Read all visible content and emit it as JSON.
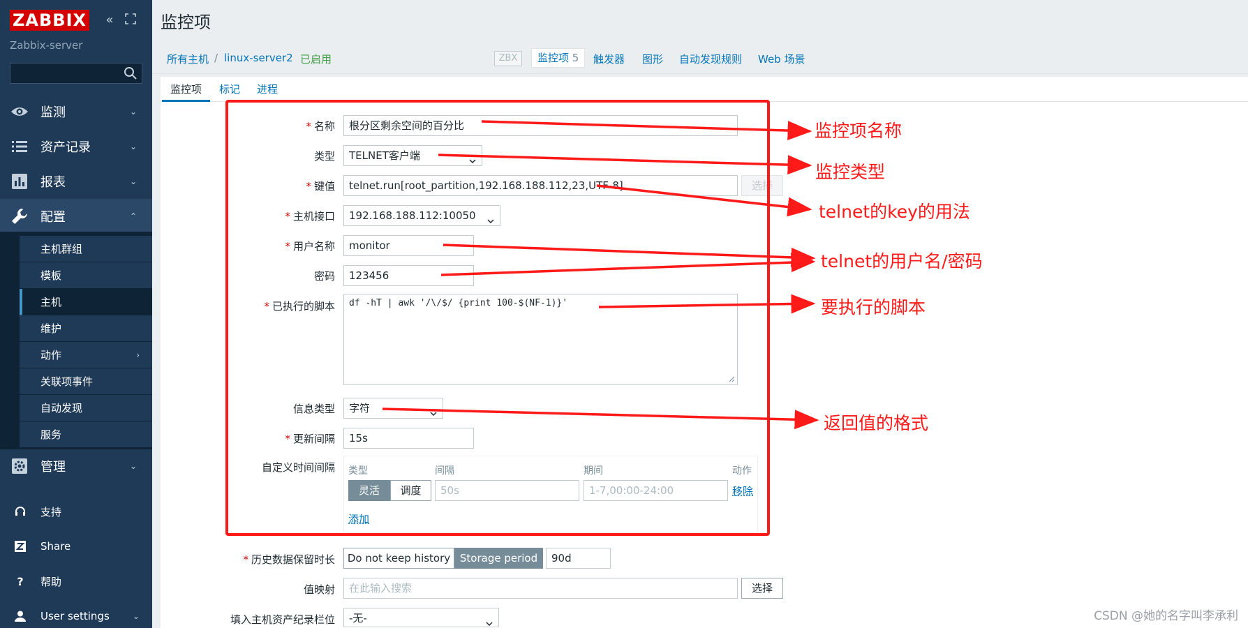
{
  "sidebar": {
    "logo": "ZABBIX",
    "server": "Zabbix-server",
    "search_placeholder": "",
    "menu": [
      {
        "label": "监测"
      },
      {
        "label": "资产记录"
      },
      {
        "label": "报表"
      },
      {
        "label": "配置"
      },
      {
        "label": "管理"
      }
    ],
    "config_sub": [
      {
        "label": "主机群组"
      },
      {
        "label": "模板"
      },
      {
        "label": "主机"
      },
      {
        "label": "维护"
      },
      {
        "label": "动作"
      },
      {
        "label": "关联项事件"
      },
      {
        "label": "自动发现"
      },
      {
        "label": "服务"
      }
    ],
    "bottom": [
      {
        "label": "支持"
      },
      {
        "label": "Share"
      },
      {
        "label": "帮助"
      },
      {
        "label": "User settings"
      }
    ]
  },
  "page_title": "监控项",
  "hostbar": {
    "all_hosts": "所有主机",
    "separator": "/",
    "host": "linux-server2",
    "status": "已启用",
    "zbx": "ZBX",
    "items_label": "监控项",
    "items_count": "5",
    "triggers": "触发器",
    "graphs": "图形",
    "discovery": "自动发现规则",
    "web": "Web 场景"
  },
  "tabs": [
    "监控项",
    "标记",
    "进程"
  ],
  "form": {
    "name_label": "名称",
    "name_value": "根分区剩余空间的百分比",
    "type_label": "类型",
    "type_value": "TELNET客户端",
    "key_label": "键值",
    "key_value": "telnet.run[root_partition,192.168.188.112,23,UTF-8]",
    "key_select": "选择",
    "iface_label": "主机接口",
    "iface_value": "192.168.188.112:10050",
    "user_label": "用户名称",
    "user_value": "monitor",
    "pass_label": "密码",
    "pass_value": "123456",
    "script_label": "已执行的脚本",
    "script_value": "df -hT | awk '/\\/$/ {print 100-$(NF-1)}'",
    "info_label": "信息类型",
    "info_value": "字符",
    "interval_label": "更新间隔",
    "interval_value": "15s",
    "custom_label": "自定义时间间隔",
    "custom": {
      "col_type": "类型",
      "col_interval": "间隔",
      "col_period": "期间",
      "col_action": "动作",
      "flexible": "灵活",
      "scheduling": "调度",
      "interval_placeholder": "50s",
      "period_placeholder": "1-7,00:00-24:00",
      "remove": "移除",
      "add": "添加"
    },
    "history_label": "历史数据保留时长",
    "history_off": "Do not keep history",
    "history_on": "Storage period",
    "history_value": "90d",
    "valuemap_label": "值映射",
    "valuemap_placeholder": "在此输入搜索",
    "valuemap_select": "选择",
    "inventory_label": "填入主机资产纪录栏位",
    "inventory_value": "-无-"
  },
  "annotations": {
    "name": "监控项名称",
    "type": "监控类型",
    "key": "telnet的key的用法",
    "userpass": "telnet的用户名/密码",
    "script": "要执行的脚本",
    "format": "返回值的格式"
  },
  "colors": {
    "sidebar_bg": "#1f3a57",
    "accent_link": "#0275b8",
    "annotation_red": "#ff1a1a",
    "logo_red": "#d40000"
  },
  "watermark": "CSDN @她的名字叫李承利"
}
